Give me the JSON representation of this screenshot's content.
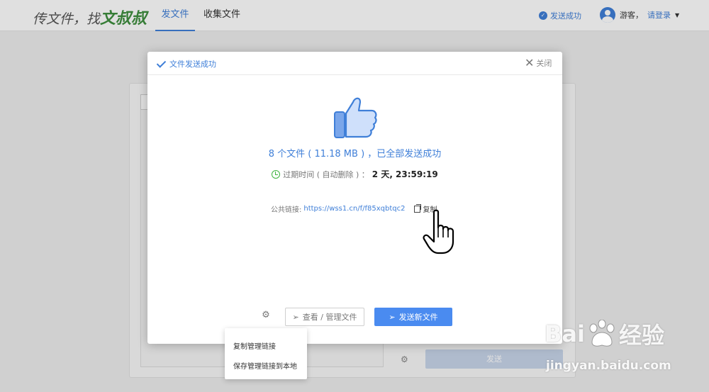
{
  "nav": {
    "logo_text": "传文件，找",
    "logo_accent": "文叔叔",
    "tabs": [
      {
        "label": "发文件",
        "active": true
      },
      {
        "label": "收集文件",
        "active": false
      }
    ],
    "status": "发送成功",
    "user_guest": "游客，",
    "user_login": "请登录"
  },
  "modal": {
    "title": "文件发送成功",
    "close_label": "关闭",
    "summary": "8 个文件 ( 11.18 MB ) ，已全部发送成功",
    "expire_label": "过期时间 ( 自动删除 ) ：",
    "expire_value": "2 天, 23:59:19",
    "link_label": "公共链接:",
    "link_url": "https://wss1.cn/f/f85xqbtqc2",
    "copy_label": "复制",
    "manage_button": "查看 / 管理文件",
    "new_button": "发送新文件"
  },
  "dropdown": {
    "items": [
      "复制管理链接",
      "保存管理链接到本地"
    ]
  },
  "background": {
    "send_button": "发送"
  },
  "watermark": {
    "brand": "Bai",
    "brand_cn": "经验",
    "url": "jingyan.baidu.com"
  },
  "colors": {
    "accent": "#3f7fd8",
    "primary_button": "#4a8bf0",
    "logo_green": "#3f8f3f",
    "clock_green": "#3fb53f"
  }
}
